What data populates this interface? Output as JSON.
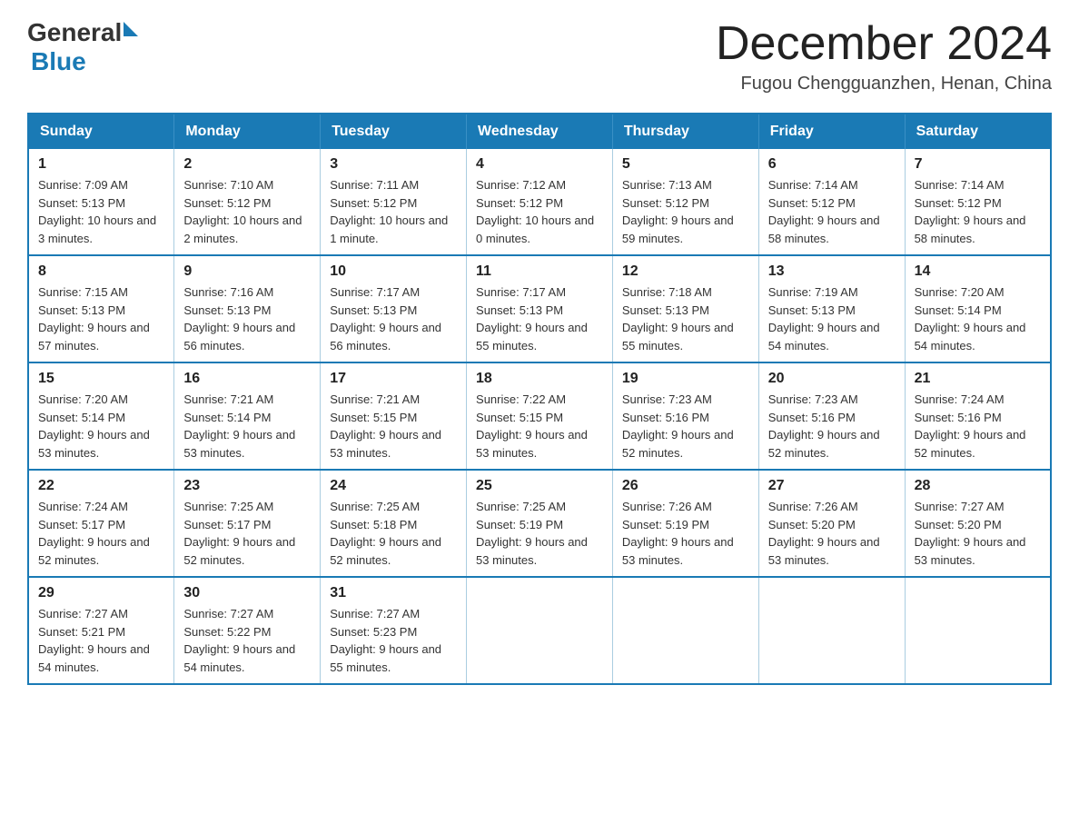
{
  "logo": {
    "text_general": "General",
    "text_blue": "Blue"
  },
  "title": {
    "month_year": "December 2024",
    "location": "Fugou Chengguanzhen, Henan, China"
  },
  "weekdays": [
    "Sunday",
    "Monday",
    "Tuesday",
    "Wednesday",
    "Thursday",
    "Friday",
    "Saturday"
  ],
  "weeks": [
    [
      {
        "day": "1",
        "sunrise": "Sunrise: 7:09 AM",
        "sunset": "Sunset: 5:13 PM",
        "daylight": "Daylight: 10 hours and 3 minutes."
      },
      {
        "day": "2",
        "sunrise": "Sunrise: 7:10 AM",
        "sunset": "Sunset: 5:12 PM",
        "daylight": "Daylight: 10 hours and 2 minutes."
      },
      {
        "day": "3",
        "sunrise": "Sunrise: 7:11 AM",
        "sunset": "Sunset: 5:12 PM",
        "daylight": "Daylight: 10 hours and 1 minute."
      },
      {
        "day": "4",
        "sunrise": "Sunrise: 7:12 AM",
        "sunset": "Sunset: 5:12 PM",
        "daylight": "Daylight: 10 hours and 0 minutes."
      },
      {
        "day": "5",
        "sunrise": "Sunrise: 7:13 AM",
        "sunset": "Sunset: 5:12 PM",
        "daylight": "Daylight: 9 hours and 59 minutes."
      },
      {
        "day": "6",
        "sunrise": "Sunrise: 7:14 AM",
        "sunset": "Sunset: 5:12 PM",
        "daylight": "Daylight: 9 hours and 58 minutes."
      },
      {
        "day": "7",
        "sunrise": "Sunrise: 7:14 AM",
        "sunset": "Sunset: 5:12 PM",
        "daylight": "Daylight: 9 hours and 58 minutes."
      }
    ],
    [
      {
        "day": "8",
        "sunrise": "Sunrise: 7:15 AM",
        "sunset": "Sunset: 5:13 PM",
        "daylight": "Daylight: 9 hours and 57 minutes."
      },
      {
        "day": "9",
        "sunrise": "Sunrise: 7:16 AM",
        "sunset": "Sunset: 5:13 PM",
        "daylight": "Daylight: 9 hours and 56 minutes."
      },
      {
        "day": "10",
        "sunrise": "Sunrise: 7:17 AM",
        "sunset": "Sunset: 5:13 PM",
        "daylight": "Daylight: 9 hours and 56 minutes."
      },
      {
        "day": "11",
        "sunrise": "Sunrise: 7:17 AM",
        "sunset": "Sunset: 5:13 PM",
        "daylight": "Daylight: 9 hours and 55 minutes."
      },
      {
        "day": "12",
        "sunrise": "Sunrise: 7:18 AM",
        "sunset": "Sunset: 5:13 PM",
        "daylight": "Daylight: 9 hours and 55 minutes."
      },
      {
        "day": "13",
        "sunrise": "Sunrise: 7:19 AM",
        "sunset": "Sunset: 5:13 PM",
        "daylight": "Daylight: 9 hours and 54 minutes."
      },
      {
        "day": "14",
        "sunrise": "Sunrise: 7:20 AM",
        "sunset": "Sunset: 5:14 PM",
        "daylight": "Daylight: 9 hours and 54 minutes."
      }
    ],
    [
      {
        "day": "15",
        "sunrise": "Sunrise: 7:20 AM",
        "sunset": "Sunset: 5:14 PM",
        "daylight": "Daylight: 9 hours and 53 minutes."
      },
      {
        "day": "16",
        "sunrise": "Sunrise: 7:21 AM",
        "sunset": "Sunset: 5:14 PM",
        "daylight": "Daylight: 9 hours and 53 minutes."
      },
      {
        "day": "17",
        "sunrise": "Sunrise: 7:21 AM",
        "sunset": "Sunset: 5:15 PM",
        "daylight": "Daylight: 9 hours and 53 minutes."
      },
      {
        "day": "18",
        "sunrise": "Sunrise: 7:22 AM",
        "sunset": "Sunset: 5:15 PM",
        "daylight": "Daylight: 9 hours and 53 minutes."
      },
      {
        "day": "19",
        "sunrise": "Sunrise: 7:23 AM",
        "sunset": "Sunset: 5:16 PM",
        "daylight": "Daylight: 9 hours and 52 minutes."
      },
      {
        "day": "20",
        "sunrise": "Sunrise: 7:23 AM",
        "sunset": "Sunset: 5:16 PM",
        "daylight": "Daylight: 9 hours and 52 minutes."
      },
      {
        "day": "21",
        "sunrise": "Sunrise: 7:24 AM",
        "sunset": "Sunset: 5:16 PM",
        "daylight": "Daylight: 9 hours and 52 minutes."
      }
    ],
    [
      {
        "day": "22",
        "sunrise": "Sunrise: 7:24 AM",
        "sunset": "Sunset: 5:17 PM",
        "daylight": "Daylight: 9 hours and 52 minutes."
      },
      {
        "day": "23",
        "sunrise": "Sunrise: 7:25 AM",
        "sunset": "Sunset: 5:17 PM",
        "daylight": "Daylight: 9 hours and 52 minutes."
      },
      {
        "day": "24",
        "sunrise": "Sunrise: 7:25 AM",
        "sunset": "Sunset: 5:18 PM",
        "daylight": "Daylight: 9 hours and 52 minutes."
      },
      {
        "day": "25",
        "sunrise": "Sunrise: 7:25 AM",
        "sunset": "Sunset: 5:19 PM",
        "daylight": "Daylight: 9 hours and 53 minutes."
      },
      {
        "day": "26",
        "sunrise": "Sunrise: 7:26 AM",
        "sunset": "Sunset: 5:19 PM",
        "daylight": "Daylight: 9 hours and 53 minutes."
      },
      {
        "day": "27",
        "sunrise": "Sunrise: 7:26 AM",
        "sunset": "Sunset: 5:20 PM",
        "daylight": "Daylight: 9 hours and 53 minutes."
      },
      {
        "day": "28",
        "sunrise": "Sunrise: 7:27 AM",
        "sunset": "Sunset: 5:20 PM",
        "daylight": "Daylight: 9 hours and 53 minutes."
      }
    ],
    [
      {
        "day": "29",
        "sunrise": "Sunrise: 7:27 AM",
        "sunset": "Sunset: 5:21 PM",
        "daylight": "Daylight: 9 hours and 54 minutes."
      },
      {
        "day": "30",
        "sunrise": "Sunrise: 7:27 AM",
        "sunset": "Sunset: 5:22 PM",
        "daylight": "Daylight: 9 hours and 54 minutes."
      },
      {
        "day": "31",
        "sunrise": "Sunrise: 7:27 AM",
        "sunset": "Sunset: 5:23 PM",
        "daylight": "Daylight: 9 hours and 55 minutes."
      },
      null,
      null,
      null,
      null
    ]
  ]
}
